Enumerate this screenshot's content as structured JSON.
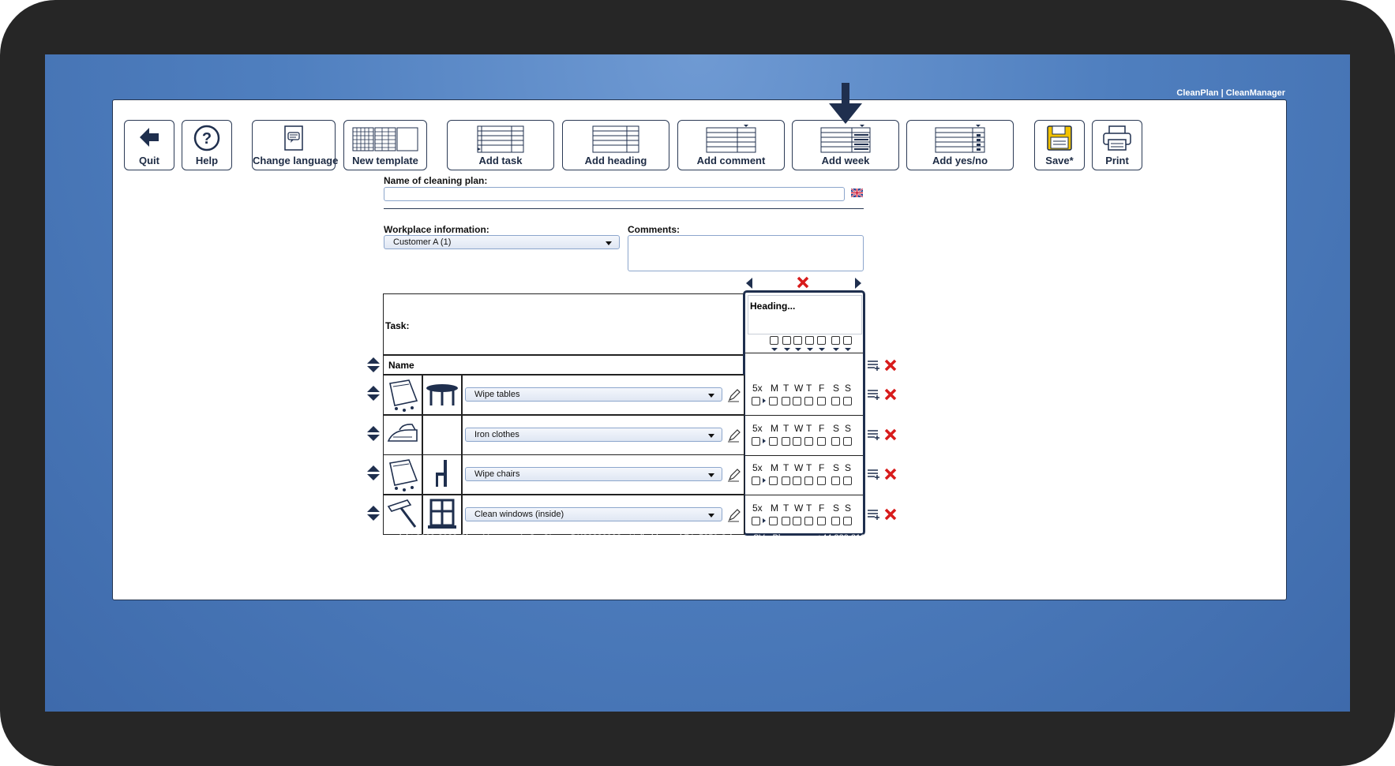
{
  "brand": "CleanPlan | CleanManager",
  "toolbar": {
    "quit": "Quit",
    "help": "Help",
    "change_language": "Change language",
    "new_template": "New template",
    "add_task": "Add task",
    "add_heading": "Add heading",
    "add_comment": "Add comment",
    "add_week": "Add week",
    "add_yesno": "Add yes/no",
    "save": "Save*",
    "print": "Print"
  },
  "form": {
    "plan_name_label": "Name of cleaning plan:",
    "plan_name_value": "",
    "workplace_label": "Workplace information:",
    "workplace_value": "Customer A (1)",
    "comments_label": "Comments:"
  },
  "table": {
    "task_label": "Task:",
    "name_label": "Name",
    "heading_placeholder": "Heading...",
    "rows": [
      {
        "task": "Wipe tables",
        "freq": "5x",
        "icon1": "wet-cloth-icon",
        "icon2": "table-icon"
      },
      {
        "task": "Iron clothes",
        "freq": "5x",
        "icon1": "iron-icon",
        "icon2": ""
      },
      {
        "task": "Wipe chairs",
        "freq": "5x",
        "icon1": "wet-cloth-icon",
        "icon2": "chair-icon"
      },
      {
        "task": "Clean windows (inside)",
        "freq": "5x",
        "icon1": "squeegee-icon",
        "icon2": "window-icon"
      }
    ],
    "days": [
      "M",
      "T",
      "W",
      "T",
      "F",
      "S",
      "S"
    ]
  },
  "footer": {
    "copyright": "© Copyright 2009-2023 CleanManager ApS - CI no.: DK39230992 - Holkebjergvej 74, 5250 Odense SV - Phone no.: +44 330 818 3119 - E-mail: support@cleanmanager.uk",
    "cookies": "Cookies on this webpage"
  },
  "colors": {
    "accent": "#1f2f4e",
    "delete": "#d81b1b",
    "background": "#4f7fbf"
  }
}
